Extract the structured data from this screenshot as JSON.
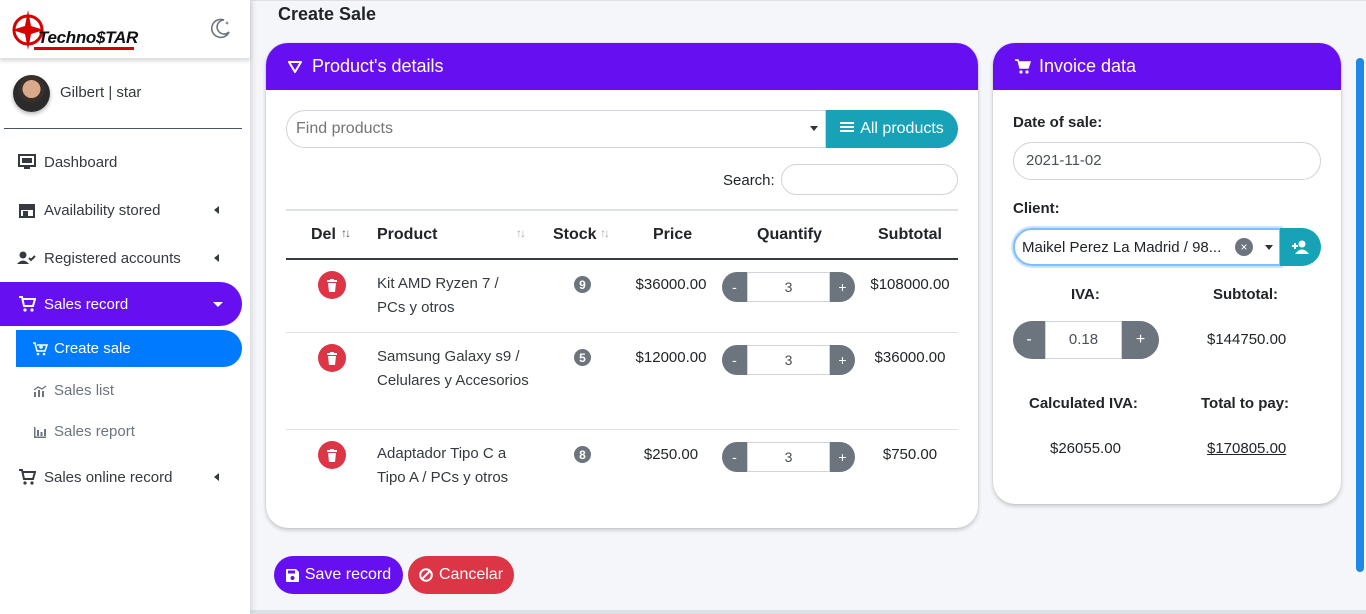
{
  "brand": {
    "logo_text": "Techno$TAR",
    "theme_toggle_icon": "moon-icon"
  },
  "user": {
    "name": "Gilbert | star"
  },
  "sidebar": {
    "items": [
      {
        "label": "Dashboard",
        "icon": "monitor-icon"
      },
      {
        "label": "Availability stored",
        "icon": "store-icon"
      },
      {
        "label": "Registered accounts",
        "icon": "user-check-icon"
      },
      {
        "label": "Sales record",
        "icon": "cart-icon",
        "active": true
      },
      {
        "label": "Sales online record",
        "icon": "cart-icon"
      }
    ],
    "sub_items": [
      {
        "label": "Create sale",
        "icon": "cart-plus-icon",
        "active": true
      },
      {
        "label": "Sales list",
        "icon": "chart-line-icon"
      },
      {
        "label": "Sales report",
        "icon": "bar-chart-icon"
      }
    ]
  },
  "page": {
    "title": "Create Sale"
  },
  "products_card": {
    "title": "Product's details",
    "find_placeholder": "Find products",
    "all_products_label": "All products",
    "search_label": "Search:",
    "columns": [
      "Del",
      "Product",
      "Stock",
      "Price",
      "Quantify",
      "Subtotal"
    ],
    "rows": [
      {
        "product": "Kit AMD Ryzen 7 / PCs y otros",
        "stock": "9",
        "price": "$36000.00",
        "quantity": "3",
        "subtotal": "$108000.00"
      },
      {
        "product": "Samsung Galaxy s9 / Celulares y Accesorios",
        "stock": "5",
        "price": "$12000.00",
        "quantity": "3",
        "subtotal": "$36000.00"
      },
      {
        "product": "Adaptador Tipo C a Tipo A / PCs y otros",
        "stock": "8",
        "price": "$250.00",
        "quantity": "3",
        "subtotal": "$750.00"
      }
    ]
  },
  "invoice_card": {
    "title": "Invoice data",
    "date_label": "Date of sale:",
    "date_value": "2021-11-02",
    "client_label": "Client:",
    "client_value": "Maikel Perez La Madrid / 98...",
    "iva_label": "IVA:",
    "iva_value": "0.18",
    "subtotal_label": "Subtotal:",
    "subtotal_value": "$144750.00",
    "calc_iva_label": "Calculated IVA:",
    "calc_iva_value": "$26055.00",
    "total_label": "Total to pay:",
    "total_value": "$170805.00"
  },
  "actions": {
    "save_label": "Save record",
    "cancel_label": "Cancelar"
  },
  "colors": {
    "primary": "#6610f2",
    "info": "#17a2b8",
    "danger": "#dc3545",
    "active_sub": "#007bff"
  }
}
